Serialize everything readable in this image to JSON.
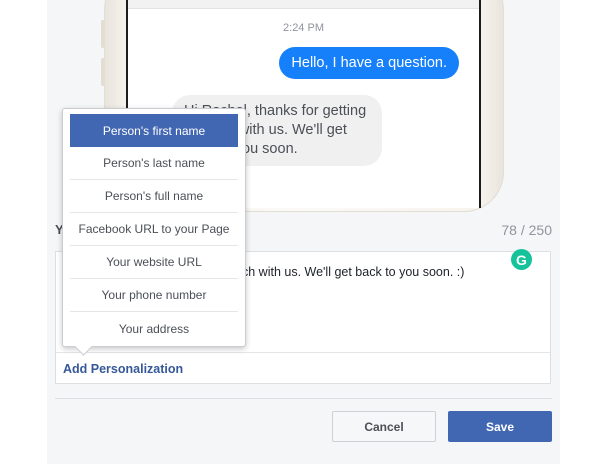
{
  "preview": {
    "timestamp": "2:24 PM",
    "outgoing_message": "Hello, I have a question.",
    "incoming_message": "Hi Rachel, thanks for getting in touch with us. We'll get back to you soon."
  },
  "form": {
    "section_label": "Y",
    "char_count": "78 / 250",
    "message_visible_text": "ch with us. We'll get back to you soon. :)",
    "grammarly_glyph": "G",
    "add_personalization": "Add Personalization"
  },
  "personalization_menu": {
    "items": [
      {
        "label": "Person's first name",
        "selected": true
      },
      {
        "label": "Person's last name",
        "selected": false
      },
      {
        "label": "Person's full name",
        "selected": false
      },
      {
        "label": "Facebook URL to your Page",
        "selected": false
      },
      {
        "label": "Your website URL",
        "selected": false
      },
      {
        "label": "Your phone number",
        "selected": false
      },
      {
        "label": "Your address",
        "selected": false
      }
    ]
  },
  "actions": {
    "cancel_label": "Cancel",
    "save_label": "Save"
  },
  "colors": {
    "brand_blue": "#4267b2",
    "messenger_blue": "#1680fb",
    "link_blue": "#365899",
    "grammarly_green": "#15c39a"
  }
}
